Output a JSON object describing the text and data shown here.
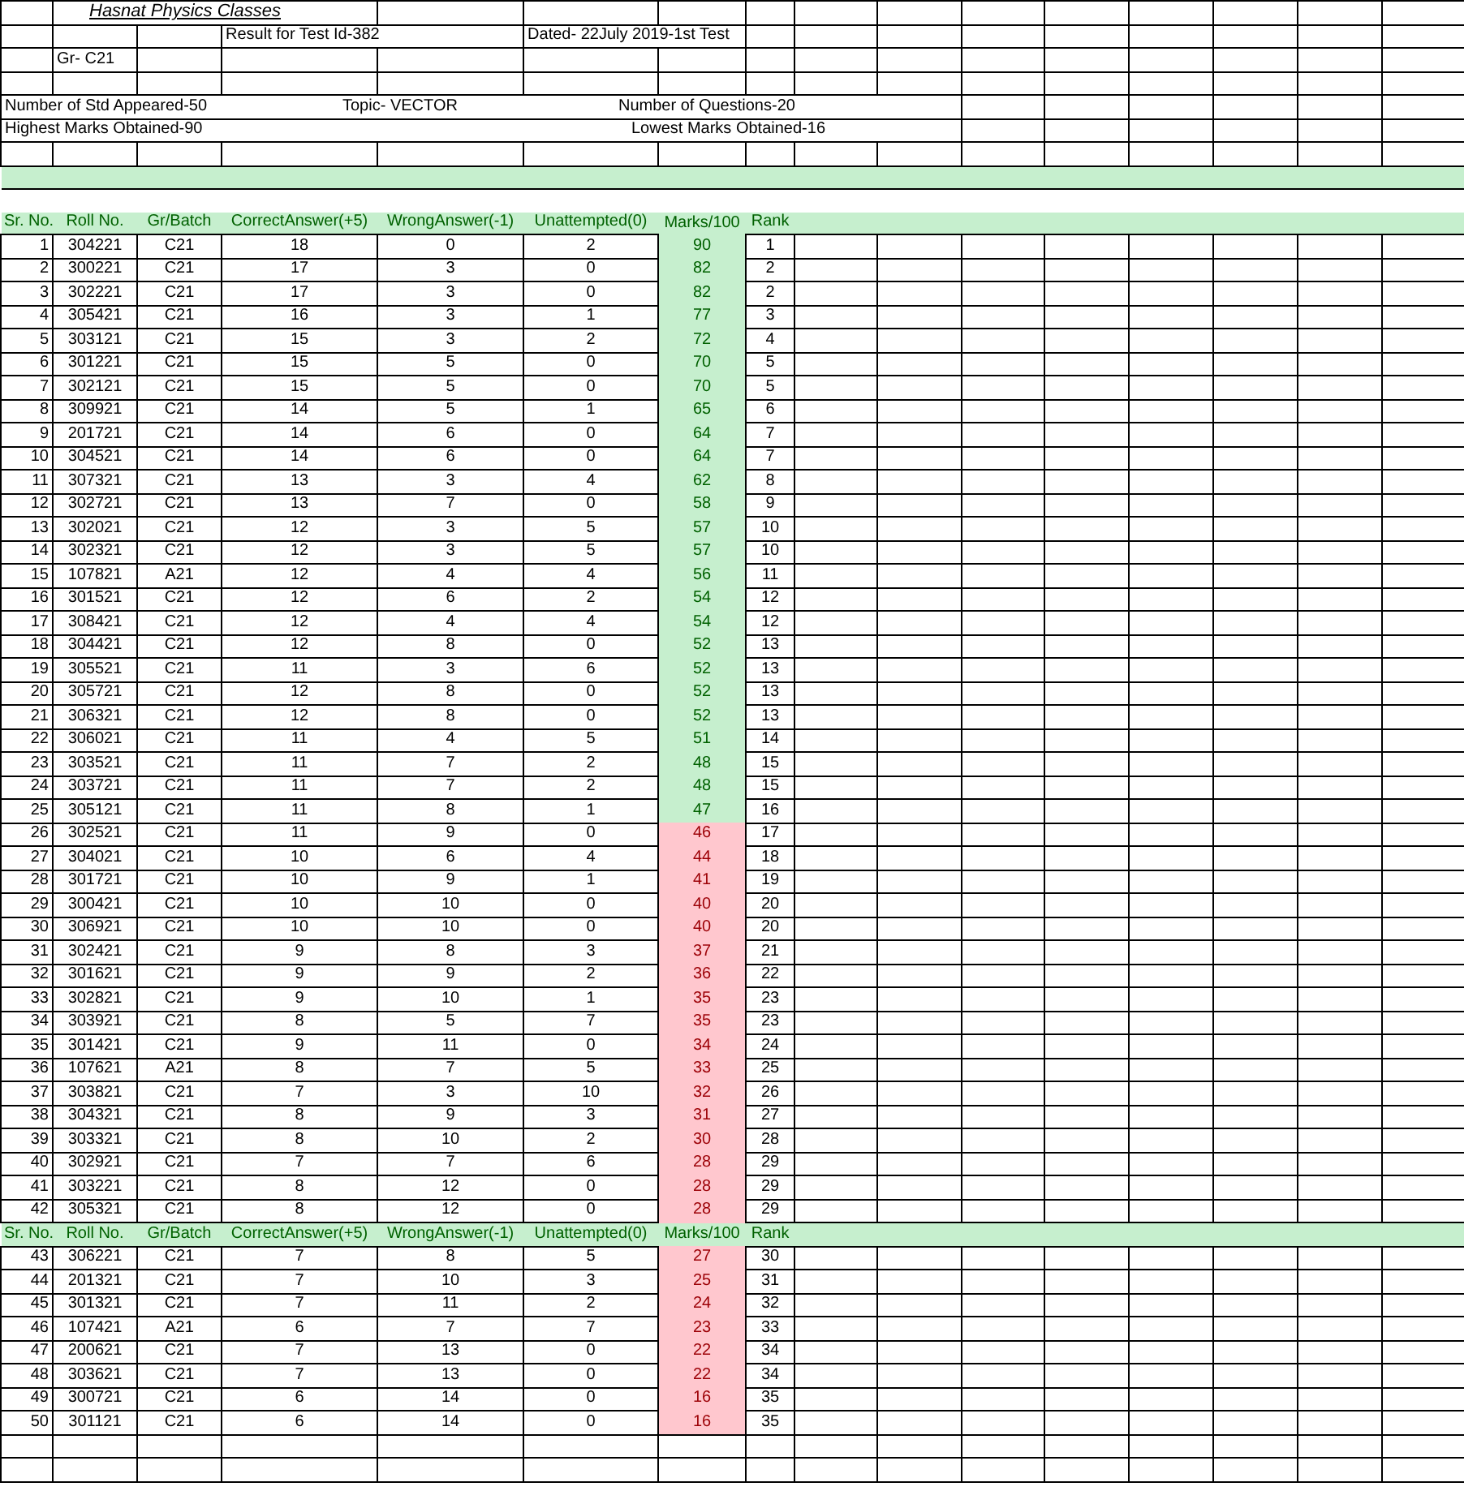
{
  "title": "Hasnat Physics Classes",
  "test_info": "Result for Test Id-382",
  "date": "Dated- 22July 2019-1st Test",
  "group": "Gr- C21",
  "summary": {
    "students": "Number of Std Appeared-50",
    "topic": "Topic- VECTOR",
    "questions": "Number of Questions-20",
    "highest": "Highest Marks Obtained-90",
    "lowest": "Lowest Marks Obtained-16"
  },
  "sections": [
    {
      "columns": [
        "Sr. No.",
        "Roll No.",
        "Gr/Batch",
        "CorrectAnswer(+5)",
        "WrongAnswer(-1)",
        "Unattempted(0)",
        "Marks/100",
        "Rank"
      ],
      "rows": [
        {
          "cells": [
            "1",
            "304221",
            "C21",
            "18",
            "0",
            "2",
            "90",
            "1"
          ],
          "color": "#c6efce"
        },
        {
          "cells": [
            "2",
            "300221",
            "C21",
            "17",
            "3",
            "0",
            "82",
            "2"
          ],
          "color": "#c6efce"
        },
        {
          "cells": [
            "3",
            "302221",
            "C21",
            "17",
            "3",
            "0",
            "82",
            "2"
          ],
          "color": "#c6efce"
        },
        {
          "cells": [
            "4",
            "305421",
            "C21",
            "16",
            "3",
            "1",
            "77",
            "3"
          ],
          "color": "#c6efce"
        },
        {
          "cells": [
            "5",
            "303121",
            "C21",
            "15",
            "3",
            "2",
            "72",
            "4"
          ],
          "color": "#c6efce"
        },
        {
          "cells": [
            "6",
            "301221",
            "C21",
            "15",
            "5",
            "0",
            "70",
            "5"
          ],
          "color": "#c6efce"
        },
        {
          "cells": [
            "7",
            "302121",
            "C21",
            "15",
            "5",
            "0",
            "70",
            "5"
          ],
          "color": "#c6efce"
        },
        {
          "cells": [
            "8",
            "309921",
            "C21",
            "14",
            "5",
            "1",
            "65",
            "6"
          ],
          "color": "#c6efce"
        },
        {
          "cells": [
            "9",
            "201721",
            "C21",
            "14",
            "6",
            "0",
            "64",
            "7"
          ],
          "color": "#c6efce"
        },
        {
          "cells": [
            "10",
            "304521",
            "C21",
            "14",
            "6",
            "0",
            "64",
            "7"
          ],
          "color": "#c6efce"
        },
        {
          "cells": [
            "11",
            "307321",
            "C21",
            "13",
            "3",
            "4",
            "62",
            "8"
          ],
          "color": "#c6efce"
        },
        {
          "cells": [
            "12",
            "302721",
            "C21",
            "13",
            "7",
            "0",
            "58",
            "9"
          ],
          "color": "#c6efce"
        },
        {
          "cells": [
            "13",
            "302021",
            "C21",
            "12",
            "3",
            "5",
            "57",
            "10"
          ],
          "color": "#c6efce"
        },
        {
          "cells": [
            "14",
            "302321",
            "C21",
            "12",
            "3",
            "5",
            "57",
            "10"
          ],
          "color": "#c6efce"
        },
        {
          "cells": [
            "15",
            "107821",
            "A21",
            "12",
            "4",
            "4",
            "56",
            "11"
          ],
          "color": "#c6efce"
        },
        {
          "cells": [
            "16",
            "301521",
            "C21",
            "12",
            "6",
            "2",
            "54",
            "12"
          ],
          "color": "#c6efce"
        },
        {
          "cells": [
            "17",
            "308421",
            "C21",
            "12",
            "4",
            "4",
            "54",
            "12"
          ],
          "color": "#c6efce"
        },
        {
          "cells": [
            "18",
            "304421",
            "C21",
            "12",
            "8",
            "0",
            "52",
            "13"
          ],
          "color": "#c6efce"
        },
        {
          "cells": [
            "19",
            "305521",
            "C21",
            "11",
            "3",
            "6",
            "52",
            "13"
          ],
          "color": "#c6efce"
        },
        {
          "cells": [
            "20",
            "305721",
            "C21",
            "12",
            "8",
            "0",
            "52",
            "13"
          ],
          "color": "#c6efce"
        },
        {
          "cells": [
            "21",
            "306321",
            "C21",
            "12",
            "8",
            "0",
            "52",
            "13"
          ],
          "color": "#c6efce"
        },
        {
          "cells": [
            "22",
            "306021",
            "C21",
            "11",
            "4",
            "5",
            "51",
            "14"
          ],
          "color": "#c6efce"
        },
        {
          "cells": [
            "23",
            "303521",
            "C21",
            "11",
            "7",
            "2",
            "48",
            "15"
          ],
          "color": "#c6efce"
        },
        {
          "cells": [
            "24",
            "303721",
            "C21",
            "11",
            "7",
            "2",
            "48",
            "15"
          ],
          "color": "#c6efce"
        },
        {
          "cells": [
            "25",
            "305121",
            "C21",
            "11",
            "8",
            "1",
            "47",
            "16"
          ],
          "color": "#c6efce"
        },
        {
          "cells": [
            "26",
            "302521",
            "C21",
            "11",
            "9",
            "0",
            "46",
            "17"
          ],
          "color": "#ffc7ce"
        },
        {
          "cells": [
            "27",
            "304021",
            "C21",
            "10",
            "6",
            "4",
            "44",
            "18"
          ],
          "color": "#ffc7ce"
        },
        {
          "cells": [
            "28",
            "301721",
            "C21",
            "10",
            "9",
            "1",
            "41",
            "19"
          ],
          "color": "#ffc7ce"
        },
        {
          "cells": [
            "29",
            "300421",
            "C21",
            "10",
            "10",
            "0",
            "40",
            "20"
          ],
          "color": "#ffc7ce"
        },
        {
          "cells": [
            "30",
            "306921",
            "C21",
            "10",
            "10",
            "0",
            "40",
            "20"
          ],
          "color": "#ffc7ce"
        },
        {
          "cells": [
            "31",
            "302421",
            "C21",
            "9",
            "8",
            "3",
            "37",
            "21"
          ],
          "color": "#ffc7ce"
        },
        {
          "cells": [
            "32",
            "301621",
            "C21",
            "9",
            "9",
            "2",
            "36",
            "22"
          ],
          "color": "#ffc7ce"
        },
        {
          "cells": [
            "33",
            "302821",
            "C21",
            "9",
            "10",
            "1",
            "35",
            "23"
          ],
          "color": "#ffc7ce"
        },
        {
          "cells": [
            "34",
            "303921",
            "C21",
            "8",
            "5",
            "7",
            "35",
            "23"
          ],
          "color": "#ffc7ce"
        },
        {
          "cells": [
            "35",
            "301421",
            "C21",
            "9",
            "11",
            "0",
            "34",
            "24"
          ],
          "color": "#ffc7ce"
        },
        {
          "cells": [
            "36",
            "107621",
            "A21",
            "8",
            "7",
            "5",
            "33",
            "25"
          ],
          "color": "#ffc7ce"
        },
        {
          "cells": [
            "37",
            "303821",
            "C21",
            "7",
            "3",
            "10",
            "32",
            "26"
          ],
          "color": "#ffc7ce"
        },
        {
          "cells": [
            "38",
            "304321",
            "C21",
            "8",
            "9",
            "3",
            "31",
            "27"
          ],
          "color": "#ffc7ce"
        },
        {
          "cells": [
            "39",
            "303321",
            "C21",
            "8",
            "10",
            "2",
            "30",
            "28"
          ],
          "color": "#ffc7ce"
        },
        {
          "cells": [
            "40",
            "302921",
            "C21",
            "7",
            "7",
            "6",
            "28",
            "29"
          ],
          "color": "#ffc7ce"
        },
        {
          "cells": [
            "41",
            "303221",
            "C21",
            "8",
            "12",
            "0",
            "28",
            "29"
          ],
          "color": "#ffc7ce"
        },
        {
          "cells": [
            "42",
            "305321",
            "C21",
            "8",
            "12",
            "0",
            "28",
            "29"
          ],
          "color": "#ffc7ce"
        }
      ]
    },
    {
      "columns": [
        "Sr. No.",
        "Roll No.",
        "Gr/Batch",
        "CorrectAnswer(+5)",
        "WrongAnswer(-1)",
        "Unattempted(0)",
        "Marks/100",
        "Rank"
      ],
      "rows": [
        {
          "cells": [
            "43",
            "306221",
            "C21",
            "7",
            "8",
            "5",
            "27",
            "30"
          ],
          "color": "#ffc7ce"
        },
        {
          "cells": [
            "44",
            "201321",
            "C21",
            "7",
            "10",
            "3",
            "25",
            "31"
          ],
          "color": "#ffc7ce"
        },
        {
          "cells": [
            "45",
            "301321",
            "C21",
            "7",
            "11",
            "2",
            "24",
            "32"
          ],
          "color": "#ffc7ce"
        },
        {
          "cells": [
            "46",
            "107421",
            "A21",
            "6",
            "7",
            "7",
            "23",
            "33"
          ],
          "color": "#ffc7ce"
        },
        {
          "cells": [
            "47",
            "200621",
            "C21",
            "7",
            "13",
            "0",
            "22",
            "34"
          ],
          "color": "#ffc7ce"
        },
        {
          "cells": [
            "48",
            "303621",
            "C21",
            "7",
            "13",
            "0",
            "22",
            "34"
          ],
          "color": "#ffc7ce"
        },
        {
          "cells": [
            "49",
            "300721",
            "C21",
            "6",
            "14",
            "0",
            "16",
            "35"
          ],
          "color": "#ffc7ce"
        },
        {
          "cells": [
            "50",
            "301121",
            "C21",
            "6",
            "14",
            "0",
            "16",
            "35"
          ],
          "color": "#ffc7ce"
        }
      ]
    }
  ]
}
